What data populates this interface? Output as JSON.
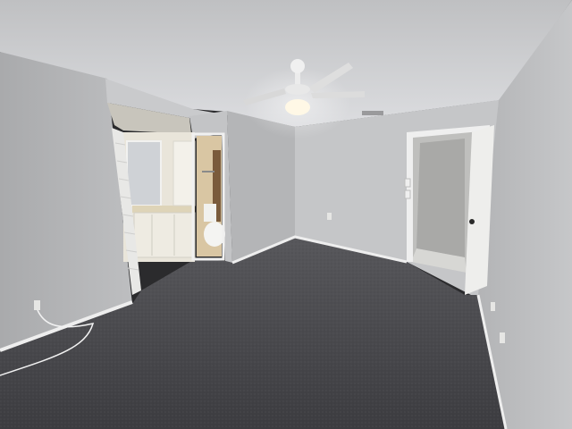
{
  "image": {
    "subject": "empty-bedroom-interior",
    "colors": {
      "ceiling": "#d3d4d6",
      "wall_left": "#b7b8ba",
      "wall_back": "#c4c5c7",
      "wall_right": "#bcbdbf",
      "carpet": "#4a4a4e",
      "trim": "#eeeeee",
      "door": "#efefef",
      "vanity": "#e7e4db",
      "bath_wall": "#d9c6a3",
      "light": "#fff8e6"
    }
  }
}
